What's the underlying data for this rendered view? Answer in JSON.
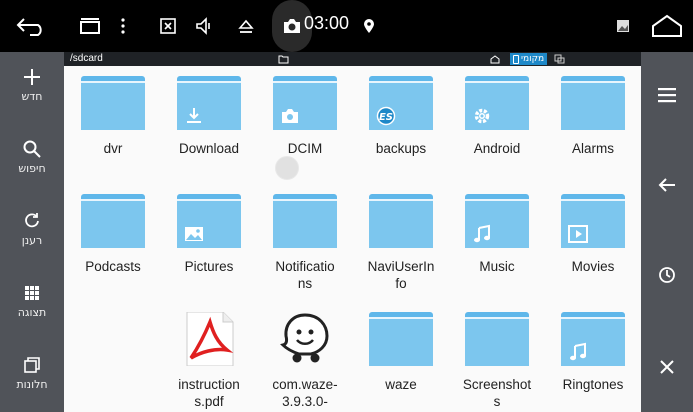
{
  "statusbar": {
    "time": "03:00",
    "icons": [
      "back-arrow-icon",
      "recent-apps-icon",
      "overflow-menu-icon",
      "close-box-icon",
      "volume-icon",
      "eject-icon",
      "camera-icon",
      "location-pin-icon",
      "notification-image-icon",
      "home-icon"
    ]
  },
  "path": {
    "current": "/sdcard",
    "local_label": "מקומי"
  },
  "left_panel": {
    "items": [
      {
        "label": "חדש",
        "icon": "plus-icon"
      },
      {
        "label": "חיפוש",
        "icon": "search-icon"
      },
      {
        "label": "רענן",
        "icon": "refresh-icon"
      },
      {
        "label": "תצוגה",
        "icon": "grid-view-icon"
      },
      {
        "label": "חלונות",
        "icon": "windows-icon"
      }
    ]
  },
  "right_panel": {
    "icons": [
      "hamburger-menu-icon",
      "back-arrow-icon",
      "history-clock-icon",
      "close-icon"
    ]
  },
  "items": [
    {
      "name": "dvr",
      "kind": "folder",
      "badge": ""
    },
    {
      "name": "Download",
      "kind": "folder",
      "badge": "download"
    },
    {
      "name": "DCIM",
      "kind": "folder",
      "badge": "camera"
    },
    {
      "name": "backups",
      "kind": "folder",
      "badge": "es"
    },
    {
      "name": "Android",
      "kind": "folder",
      "badge": "gear"
    },
    {
      "name": "Alarms",
      "kind": "folder",
      "badge": ""
    },
    {
      "name": "Podcasts",
      "kind": "folder",
      "badge": ""
    },
    {
      "name": "Pictures",
      "kind": "folder",
      "badge": "image"
    },
    {
      "name": "Notificatio\nns",
      "kind": "folder",
      "badge": ""
    },
    {
      "name": "NaviUserIn\nfo",
      "kind": "folder",
      "badge": ""
    },
    {
      "name": "Music",
      "kind": "folder",
      "badge": "music"
    },
    {
      "name": "Movies",
      "kind": "folder",
      "badge": "play"
    },
    {
      "name": "",
      "kind": "empty",
      "badge": ""
    },
    {
      "name": "instruction\ns.pdf",
      "kind": "pdf",
      "badge": ""
    },
    {
      "name": "com.waze-\n3.9.3.0-",
      "kind": "waze",
      "badge": ""
    },
    {
      "name": "waze",
      "kind": "folder",
      "badge": ""
    },
    {
      "name": "Screenshot\ns",
      "kind": "folder",
      "badge": ""
    },
    {
      "name": "Ringtones",
      "kind": "folder",
      "badge": "music"
    }
  ],
  "colors": {
    "folder": "#7cc6ee",
    "panel": "#505359",
    "accent": "#1e88c8"
  }
}
